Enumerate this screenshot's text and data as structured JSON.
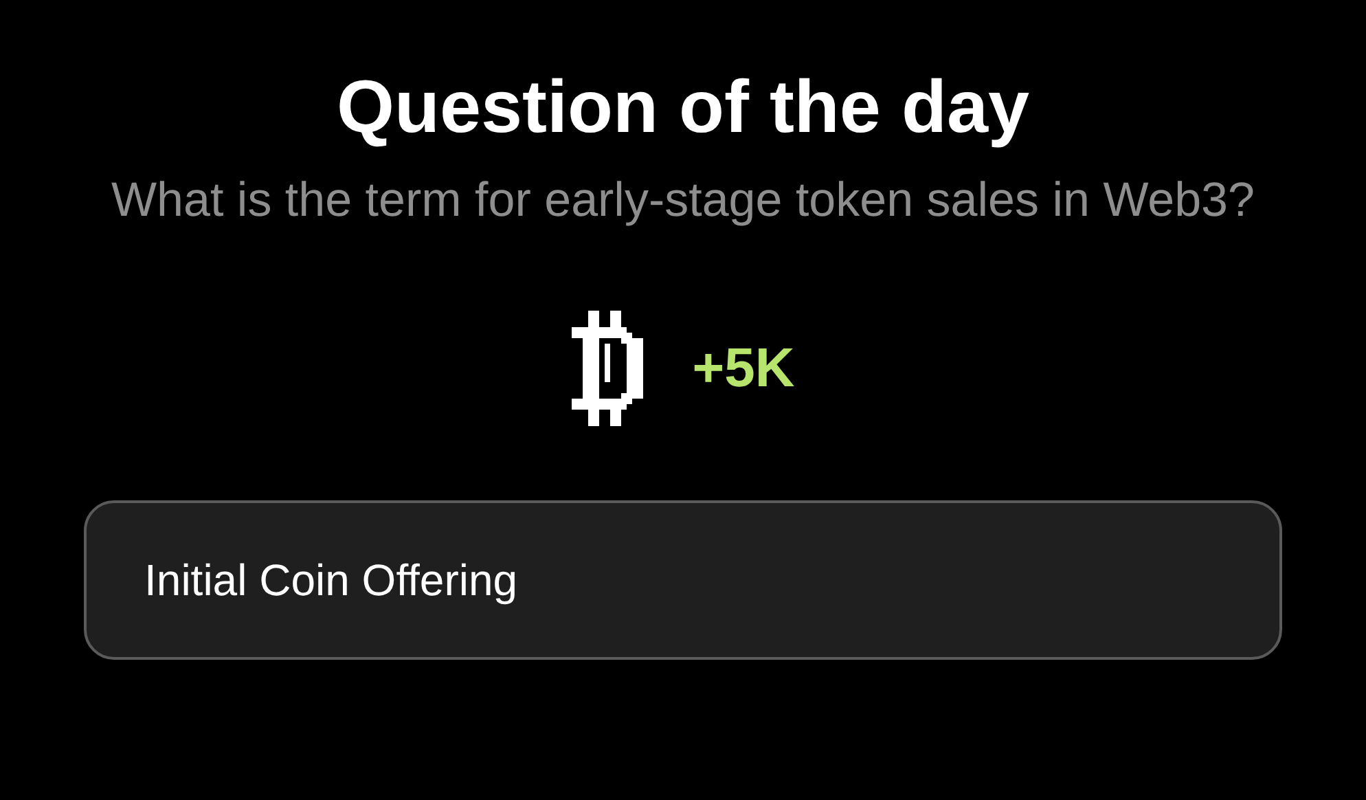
{
  "title": "Question of the day",
  "question": "What is the term for early-stage token sales in Web3?",
  "reward": {
    "amount": "+5K"
  },
  "answer": {
    "text": "Initial Coin Offering"
  }
}
